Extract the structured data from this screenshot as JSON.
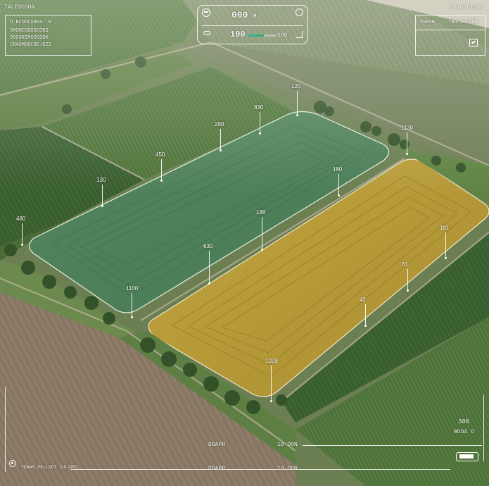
{
  "header": {
    "top_left_title": "TALESCOON",
    "top_right_title": "Comparison"
  },
  "info_panel_left": {
    "line1": "O BCOOCSRES: R",
    "line2": "OROMCOOOOCORS",
    "line3": "OOCORIMOOOSOK",
    "line4": "CRAOMOOCRE:RZS"
  },
  "gauge": {
    "top_value": "000",
    "top_unit": "M",
    "bottom_value": "100",
    "bottom_right_value": "680",
    "bar_fill_fraction": 0.55
  },
  "info_panel_right": {
    "label_left": "DSRSB",
    "label_right": "TRACSOCOON"
  },
  "bottom_right": {
    "value_top": "300",
    "value_bottom": "BODA O"
  },
  "bottom_bar": {
    "row1_label_center": "DDAPR",
    "row1_label_right": "10 OON",
    "row2_label_left": "TDAAS PELLOOT CULIPEL",
    "row2_label_center": "DDAPR",
    "row2_label_right": "10 OON"
  },
  "field_markers": [
    {
      "id": "marker-120",
      "label": "120"
    },
    {
      "id": "marker-830",
      "label": "830"
    },
    {
      "id": "marker-290",
      "label": "290"
    },
    {
      "id": "marker-1130",
      "label": "1130"
    },
    {
      "id": "marker-450",
      "label": "450"
    },
    {
      "id": "marker-180-a",
      "label": "180"
    },
    {
      "id": "marker-130",
      "label": "130"
    },
    {
      "id": "marker-480",
      "label": "480"
    },
    {
      "id": "marker-188",
      "label": "188"
    },
    {
      "id": "marker-181",
      "label": "181"
    },
    {
      "id": "marker-630",
      "label": "630"
    },
    {
      "id": "marker-61",
      "label": "61"
    },
    {
      "id": "marker-1100",
      "label": "1100"
    },
    {
      "id": "marker-42",
      "label": "42"
    },
    {
      "id": "marker-1028",
      "label": "1028"
    }
  ],
  "colors": {
    "green_field": "#4c7e58",
    "yellow_field": "#b89c38",
    "hud_line": "#ffffff"
  }
}
